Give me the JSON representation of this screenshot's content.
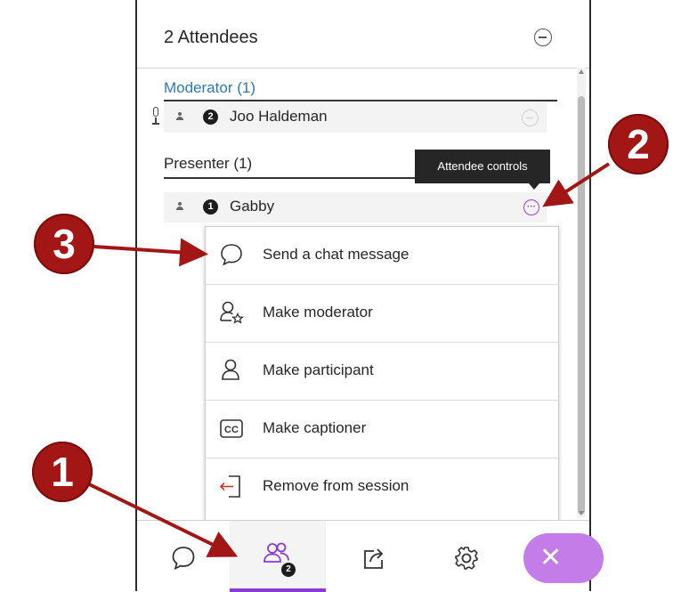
{
  "header": {
    "title": "2 Attendees"
  },
  "sections": {
    "moderator": {
      "label": "Moderator (1)",
      "name": "Joo Haldeman",
      "badge": "2"
    },
    "presenter": {
      "label": "Presenter (1)",
      "name": "Gabby",
      "badge": "1"
    }
  },
  "tooltip": {
    "text": "Attendee controls"
  },
  "menu": {
    "items": [
      {
        "label": "Send a chat message",
        "icon": "chat-bubble-icon"
      },
      {
        "label": "Make moderator",
        "icon": "user-star-icon"
      },
      {
        "label": "Make participant",
        "icon": "user-icon"
      },
      {
        "label": "Make captioner",
        "icon": "cc-icon"
      },
      {
        "label": "Remove from session",
        "icon": "exit-door-icon"
      }
    ]
  },
  "tabbar": {
    "tabs": [
      {
        "name": "chat",
        "icon": "chat-bubble-icon"
      },
      {
        "name": "attendees",
        "icon": "attendees-icon",
        "badge": "2"
      },
      {
        "name": "share-content",
        "icon": "share-icon"
      },
      {
        "name": "settings",
        "icon": "gear-icon"
      }
    ],
    "close_label": "✕"
  },
  "callouts": [
    "1",
    "2",
    "3"
  ],
  "colors": {
    "accent": "#8a3bd4",
    "callout": "#a31616",
    "moderator_label": "#2f78b7"
  }
}
